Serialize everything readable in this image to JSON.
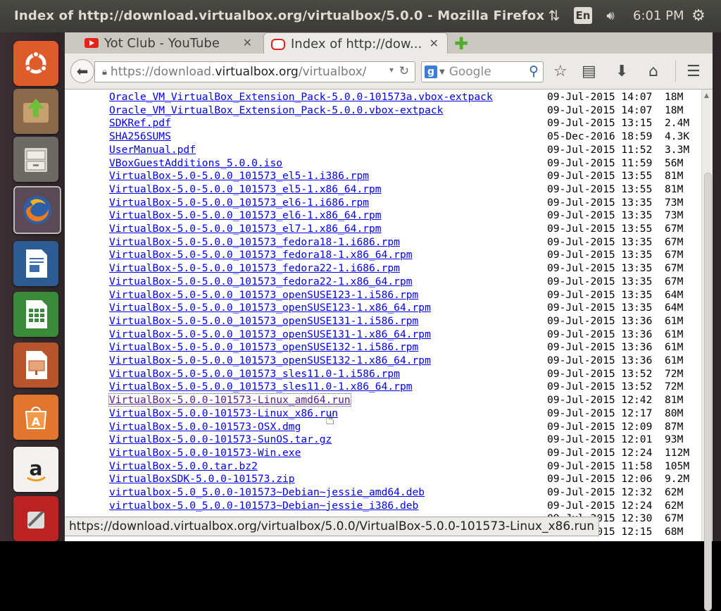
{
  "window": {
    "title": "Index of http://download.virtualbox.org/virtualbox/5.0.0 - Mozilla Firefox"
  },
  "panel": {
    "language": "En",
    "clock": "6:01 PM",
    "icons": [
      "network-icon",
      "volume-icon",
      "settings-gear-icon"
    ]
  },
  "tabs": [
    {
      "label": "Yot Club - YouTube",
      "favicon": "youtube-icon",
      "active": false
    },
    {
      "label": "Index of http://dow...",
      "favicon": "oracle-icon",
      "active": true
    }
  ],
  "toolbar": {
    "url_prefix": "https://download.",
    "url_domain": "virtualbox.org",
    "url_suffix": "/virtualbox/",
    "search_placeholder": "Google"
  },
  "files": [
    {
      "name": "Oracle_VM_VirtualBox_Extension_Pack-5.0.0-101573a.vbox-extpack",
      "date": "09-Jul-2015 14:07",
      "size": "18M"
    },
    {
      "name": "Oracle_VM_VirtualBox_Extension_Pack-5.0.0.vbox-extpack",
      "date": "09-Jul-2015 14:07",
      "size": "18M"
    },
    {
      "name": "SDKRef.pdf",
      "date": "09-Jul-2015 13:15",
      "size": "2.4M"
    },
    {
      "name": "SHA256SUMS",
      "date": "05-Dec-2016 18:59",
      "size": "4.3K"
    },
    {
      "name": "UserManual.pdf",
      "date": "09-Jul-2015 11:52",
      "size": "3.3M"
    },
    {
      "name": "VBoxGuestAdditions_5.0.0.iso",
      "date": "09-Jul-2015 11:59",
      "size": "56M"
    },
    {
      "name": "VirtualBox-5.0-5.0.0_101573_el5-1.i386.rpm",
      "date": "09-Jul-2015 13:55",
      "size": "81M"
    },
    {
      "name": "VirtualBox-5.0-5.0.0_101573_el5-1.x86_64.rpm",
      "date": "09-Jul-2015 13:55",
      "size": "81M"
    },
    {
      "name": "VirtualBox-5.0-5.0.0_101573_el6-1.i686.rpm",
      "date": "09-Jul-2015 13:35",
      "size": "73M"
    },
    {
      "name": "VirtualBox-5.0-5.0.0_101573_el6-1.x86_64.rpm",
      "date": "09-Jul-2015 13:35",
      "size": "73M"
    },
    {
      "name": "VirtualBox-5.0-5.0.0_101573_el7-1.x86_64.rpm",
      "date": "09-Jul-2015 13:55",
      "size": "67M"
    },
    {
      "name": "VirtualBox-5.0-5.0.0_101573_fedora18-1.i686.rpm",
      "date": "09-Jul-2015 13:35",
      "size": "67M"
    },
    {
      "name": "VirtualBox-5.0-5.0.0_101573_fedora18-1.x86_64.rpm",
      "date": "09-Jul-2015 13:35",
      "size": "67M"
    },
    {
      "name": "VirtualBox-5.0-5.0.0_101573_fedora22-1.i686.rpm",
      "date": "09-Jul-2015 13:35",
      "size": "67M"
    },
    {
      "name": "VirtualBox-5.0-5.0.0_101573_fedora22-1.x86_64.rpm",
      "date": "09-Jul-2015 13:35",
      "size": "67M"
    },
    {
      "name": "VirtualBox-5.0-5.0.0_101573_openSUSE123-1.i586.rpm",
      "date": "09-Jul-2015 13:35",
      "size": "64M"
    },
    {
      "name": "VirtualBox-5.0-5.0.0_101573_openSUSE123-1.x86_64.rpm",
      "date": "09-Jul-2015 13:35",
      "size": "64M"
    },
    {
      "name": "VirtualBox-5.0-5.0.0_101573_openSUSE131-1.i586.rpm",
      "date": "09-Jul-2015 13:36",
      "size": "61M"
    },
    {
      "name": "VirtualBox-5.0-5.0.0_101573_openSUSE131-1.x86_64.rpm",
      "date": "09-Jul-2015 13:36",
      "size": "61M"
    },
    {
      "name": "VirtualBox-5.0-5.0.0_101573_openSUSE132-1.i586.rpm",
      "date": "09-Jul-2015 13:36",
      "size": "61M"
    },
    {
      "name": "VirtualBox-5.0-5.0.0_101573_openSUSE132-1.x86_64.rpm",
      "date": "09-Jul-2015 13:36",
      "size": "61M"
    },
    {
      "name": "VirtualBox-5.0-5.0.0_101573_sles11.0-1.i586.rpm",
      "date": "09-Jul-2015 13:52",
      "size": "72M"
    },
    {
      "name": "VirtualBox-5.0-5.0.0_101573_sles11.0-1.x86_64.rpm",
      "date": "09-Jul-2015 13:52",
      "size": "72M"
    },
    {
      "name": "VirtualBox-5.0.0-101573-Linux_amd64.run",
      "date": "09-Jul-2015 12:42",
      "size": "81M",
      "visited": true,
      "focused": true
    },
    {
      "name": "VirtualBox-5.0.0-101573-Linux_x86.run",
      "date": "09-Jul-2015 12:17",
      "size": "80M"
    },
    {
      "name": "VirtualBox-5.0.0-101573-OSX.dmg",
      "date": "09-Jul-2015 12:09",
      "size": "87M"
    },
    {
      "name": "VirtualBox-5.0.0-101573-SunOS.tar.gz",
      "date": "09-Jul-2015 12:01",
      "size": "93M"
    },
    {
      "name": "VirtualBox-5.0.0-101573-Win.exe",
      "date": "09-Jul-2015 12:24",
      "size": "112M"
    },
    {
      "name": "VirtualBox-5.0.0.tar.bz2",
      "date": "09-Jul-2015 11:58",
      "size": "105M"
    },
    {
      "name": "VirtualBoxSDK-5.0.0-101573.zip",
      "date": "09-Jul-2015 12:06",
      "size": "9.2M"
    },
    {
      "name": "virtualbox-5.0_5.0.0-101573~Debian~jessie_amd64.deb",
      "date": "09-Jul-2015 12:32",
      "size": "62M"
    },
    {
      "name": "virtualbox-5.0_5.0.0-101573~Debian~jessie_i386.deb",
      "date": "09-Jul-2015 12:24",
      "size": "62M"
    },
    {
      "name": "",
      "date": "09-Jul-2015 12:30",
      "size": "67M"
    },
    {
      "name": "",
      "date": "09-Jul-2015 12:15",
      "size": "68M"
    }
  ],
  "status_url": "https://download.virtualbox.org/virtualbox/5.0.0/VirtualBox-5.0.0-101573-Linux_x86.run",
  "colors": {
    "link": "#0000ee",
    "visited_link": "#551a8b",
    "panel": "#3c3b37"
  }
}
